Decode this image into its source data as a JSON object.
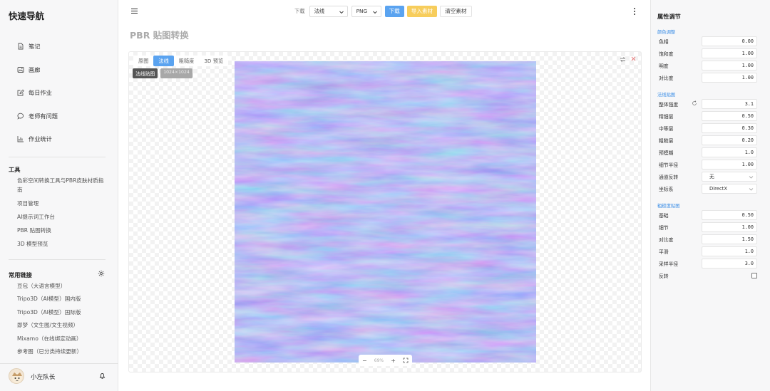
{
  "sidebar": {
    "brand": "快速导航",
    "nav": [
      {
        "label": "笔记",
        "icon": "document-icon"
      },
      {
        "label": "画廊",
        "icon": "image-icon"
      },
      {
        "label": "每日作业",
        "icon": "edit-icon"
      },
      {
        "label": "老师有问题",
        "icon": "chat-icon"
      },
      {
        "label": "作业统计",
        "icon": "chart-icon"
      }
    ],
    "tools_title": "工具",
    "tools": [
      "色彩空间转换工具与PBR皮肤材质指南",
      "项目管理",
      "AI提示词工作台",
      "PBR 贴图转换",
      "3D 模型预览"
    ],
    "links_title": "常用链接",
    "links": [
      "豆包（大语言模型）",
      "Tripo3D（AI模型）国内版",
      "Tripo3D（AI模型）国际版",
      "即梦（文生图/文生视频）",
      "Mixamo（在线绑定动画）",
      "参考图（已分类持续更新）"
    ],
    "user_name": "小左队长"
  },
  "toolbar": {
    "download_label": "下载",
    "mode_value": "法线",
    "format_value": "PNG",
    "download_button": "下载",
    "import_button": "导入素材",
    "clear_button": "清空素材"
  },
  "page_title": "PBR 贴图转换",
  "viewer": {
    "tabs": [
      "原图",
      "法线",
      "粗糙度",
      "3D 预览"
    ],
    "active_tab": 1,
    "map_label": "法线贴图",
    "resolution": "1024×1024",
    "zoom_minus": "−",
    "zoom_value": "69%",
    "zoom_plus": "+"
  },
  "panel": {
    "title": "属性调节",
    "sections": [
      {
        "title": "颜色调整",
        "rows": [
          {
            "label": "色相",
            "value": "0.00"
          },
          {
            "label": "饱和度",
            "value": "1.00"
          },
          {
            "label": "明度",
            "value": "1.00"
          },
          {
            "label": "对比度",
            "value": "1.00"
          }
        ]
      },
      {
        "title": "法线贴图",
        "rows": [
          {
            "label": "整体强度",
            "value": "3.1"
          },
          {
            "label": "精细层",
            "value": "0.50"
          },
          {
            "label": "中等层",
            "value": "0.30"
          },
          {
            "label": "粗糙层",
            "value": "0.20"
          },
          {
            "label": "预模糊",
            "value": "1.0"
          },
          {
            "label": "细节半径",
            "value": "1.00"
          },
          {
            "label": "通道反转",
            "value": "无"
          },
          {
            "label": "坐标系",
            "value": "DirectX"
          }
        ]
      },
      {
        "title": "粗糙度贴图",
        "rows": [
          {
            "label": "基础",
            "value": "0.50"
          },
          {
            "label": "细节",
            "value": "1.00"
          },
          {
            "label": "对比度",
            "value": "1.50"
          },
          {
            "label": "平滑",
            "value": "1.0"
          },
          {
            "label": "采样半径",
            "value": "3.0"
          },
          {
            "label": "反转",
            "value": ""
          }
        ]
      }
    ]
  },
  "colors": {
    "accent": "#5aa3f0",
    "warning": "#f7cd5c",
    "section_blue": "#3c8ee6",
    "normal_map_base": "#8a80f2"
  }
}
